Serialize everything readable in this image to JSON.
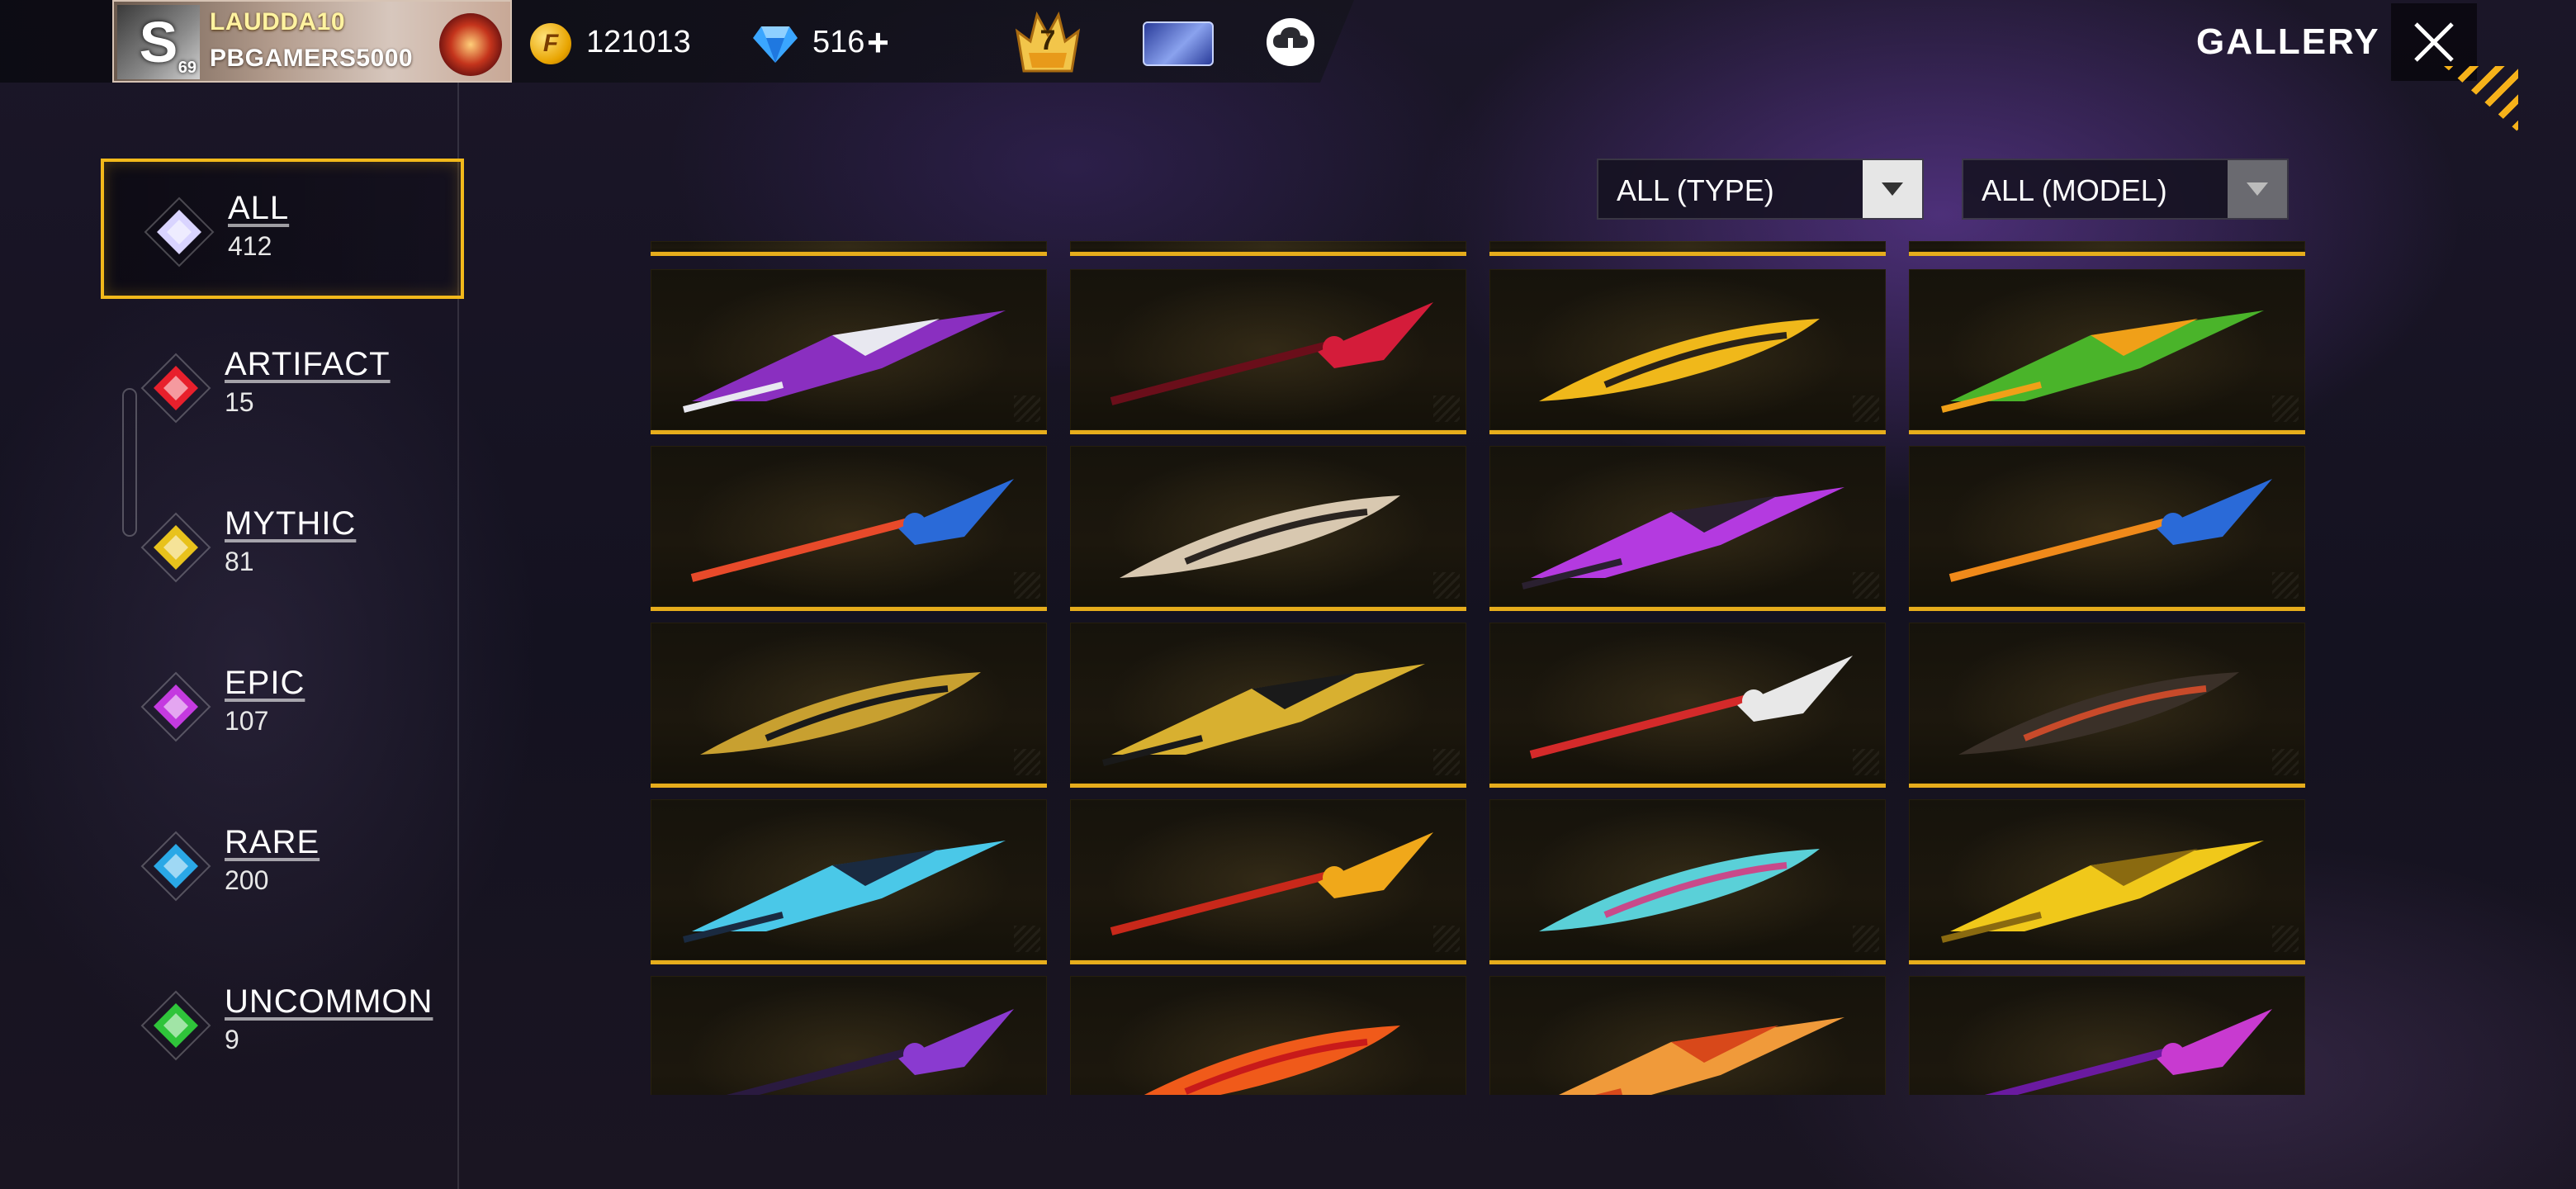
{
  "player": {
    "name": "LAUDDA10",
    "guild": "PBGAMERS5000",
    "level": "69",
    "avatar_letter": "S"
  },
  "currency": {
    "gold_icon": "gold-coin-icon",
    "gold_letter": "F",
    "gold": "121013",
    "diamond_icon": "diamond-icon",
    "diamonds": "516",
    "add_label": "+"
  },
  "vip_level": "7",
  "page_title": "GALLERY",
  "categories": [
    {
      "name": "ALL",
      "count": "412",
      "color": "#d9d4ff"
    },
    {
      "name": "ARTIFACT",
      "count": "15",
      "color": "#e8202c"
    },
    {
      "name": "MYTHIC",
      "count": "81",
      "color": "#e8c21c"
    },
    {
      "name": "EPIC",
      "count": "107",
      "color": "#c43ae0"
    },
    {
      "name": "RARE",
      "count": "200",
      "color": "#2aa8e6"
    },
    {
      "name": "UNCOMMON",
      "count": "9",
      "color": "#2fc43a"
    }
  ],
  "filters": {
    "type": "ALL (TYPE)",
    "model": "ALL (MODEL)"
  },
  "accent_color": "#e6ad1c",
  "items": [
    {
      "icon": "purple-scythe-icon",
      "colors": [
        "#8a2fc0",
        "#e8e8f0"
      ]
    },
    {
      "icon": "red-blade-icon",
      "colors": [
        "#d41c3a",
        "#6a0e1a"
      ]
    },
    {
      "icon": "golden-pan-icon",
      "colors": [
        "#f0b81a",
        "#2a2218"
      ]
    },
    {
      "icon": "green-sawblade-sword-icon",
      "colors": [
        "#4ab42a",
        "#f0a018"
      ]
    },
    {
      "icon": "flag-blade-icon",
      "colors": [
        "#2a6ad8",
        "#e84a2a"
      ]
    },
    {
      "icon": "silver-blade-icon",
      "colors": [
        "#d8c8b0",
        "#2a2420"
      ]
    },
    {
      "icon": "violet-machete-icon",
      "colors": [
        "#b43ae0",
        "#2a2030"
      ]
    },
    {
      "icon": "pinwheel-staff-icon",
      "colors": [
        "#2a6ad8",
        "#f08a1a"
      ]
    },
    {
      "icon": "gold-spear-icon",
      "colors": [
        "#c8a030",
        "#1a1a1a"
      ]
    },
    {
      "icon": "gold-trumpet-staff-icon",
      "colors": [
        "#d8b030",
        "#1a1a1a"
      ]
    },
    {
      "icon": "candy-cane-icon",
      "colors": [
        "#e8e8e8",
        "#d42a2a"
      ]
    },
    {
      "icon": "dark-katana-icon",
      "colors": [
        "#3a3028",
        "#c84a2a"
      ]
    },
    {
      "icon": "blue-katana-icon",
      "colors": [
        "#4ac8e8",
        "#1a2a40"
      ]
    },
    {
      "icon": "fire-katana-icon",
      "colors": [
        "#f0a81a",
        "#c8281a"
      ]
    },
    {
      "icon": "blue-scythe-icon",
      "colors": [
        "#5ad0d8",
        "#c84a8a"
      ]
    },
    {
      "icon": "golden-scythe-icon",
      "colors": [
        "#f0c81a",
        "#8a6a10"
      ]
    },
    {
      "icon": "shadow-staff-icon",
      "colors": [
        "#8a3ad0",
        "#2a1a40"
      ]
    },
    {
      "icon": "lava-beast-icon",
      "colors": [
        "#f05a1a",
        "#c81a1a"
      ]
    },
    {
      "icon": "fire-tiger-icon",
      "colors": [
        "#f09a3a",
        "#d8481a"
      ]
    },
    {
      "icon": "violet-tiger-icon",
      "colors": [
        "#c83ad0",
        "#6a1aa0"
      ]
    }
  ]
}
